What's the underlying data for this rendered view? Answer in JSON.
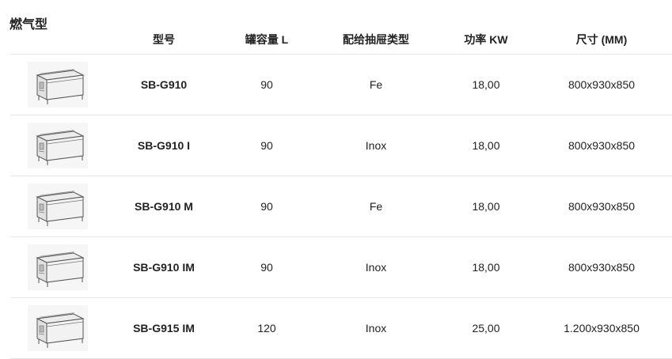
{
  "section_title": "燃气型",
  "headers": {
    "image": "",
    "model": "型号",
    "capacity": "罐容量 L",
    "drawer": "配给抽屉类型",
    "power": "功率 KW",
    "size": "尺寸 (MM)"
  },
  "rows": [
    {
      "model": "SB-G910",
      "capacity": "90",
      "drawer": "Fe",
      "power": "18,00",
      "size": "800x930x850",
      "image_icon": "griddle-appliance-image"
    },
    {
      "model": "SB-G910 I",
      "capacity": "90",
      "drawer": "Inox",
      "power": "18,00",
      "size": "800x930x850",
      "image_icon": "griddle-appliance-image"
    },
    {
      "model": "SB-G910 M",
      "capacity": "90",
      "drawer": "Fe",
      "power": "18,00",
      "size": "800x930x850",
      "image_icon": "griddle-appliance-image"
    },
    {
      "model": "SB-G910 IM",
      "capacity": "90",
      "drawer": "Inox",
      "power": "18,00",
      "size": "800x930x850",
      "image_icon": "griddle-appliance-image"
    },
    {
      "model": "SB-G915 IM",
      "capacity": "120",
      "drawer": "Inox",
      "power": "25,00",
      "size": "1.200x930x850",
      "image_icon": "griddle-appliance-image"
    }
  ]
}
